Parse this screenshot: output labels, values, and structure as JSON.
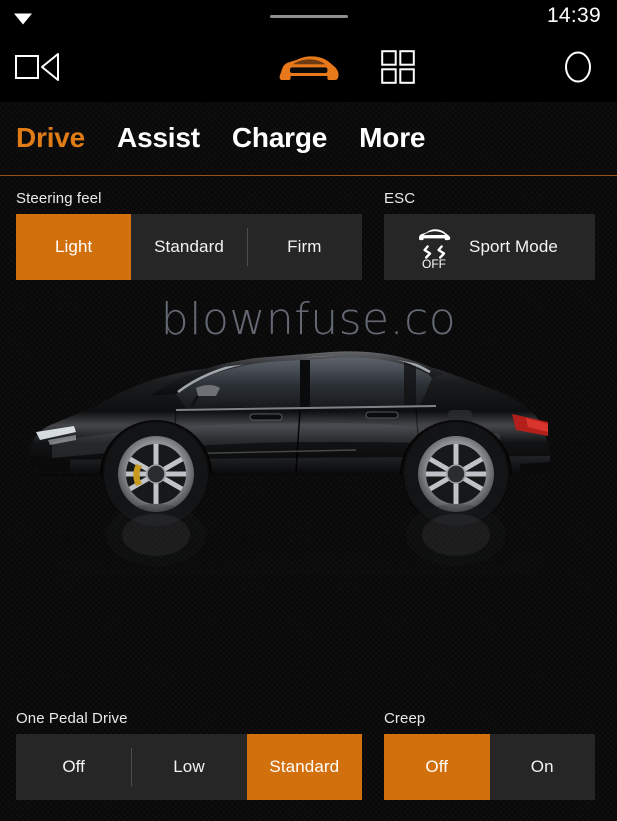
{
  "status_bar": {
    "wifi_icon": "wifi-icon",
    "drag_handle": "drag-handle",
    "time": "14:39"
  },
  "nav_bar": {
    "items": [
      {
        "name": "media-icon",
        "label": "Media"
      },
      {
        "name": "car-icon",
        "label": "Car"
      },
      {
        "name": "apps-icon",
        "label": "Apps"
      },
      {
        "name": "profile-icon",
        "label": "Profile"
      }
    ]
  },
  "tabs": [
    {
      "label": "Drive",
      "active": true
    },
    {
      "label": "Assist",
      "active": false
    },
    {
      "label": "Charge",
      "active": false
    },
    {
      "label": "More",
      "active": false
    }
  ],
  "controls": {
    "steering_feel": {
      "label": "Steering feel",
      "options": [
        {
          "label": "Light",
          "selected": true
        },
        {
          "label": "Standard",
          "selected": false
        },
        {
          "label": "Firm",
          "selected": false
        }
      ]
    },
    "esc": {
      "label": "ESC",
      "tile_label": "Sport Mode",
      "icon_name": "esc-off-icon",
      "icon_text": "OFF",
      "selected": false
    },
    "one_pedal_drive": {
      "label": "One Pedal Drive",
      "options": [
        {
          "label": "Off",
          "selected": false
        },
        {
          "label": "Low",
          "selected": false
        },
        {
          "label": "Standard",
          "selected": true
        }
      ]
    },
    "creep": {
      "label": "Creep",
      "options": [
        {
          "label": "Off",
          "selected": true
        },
        {
          "label": "On",
          "selected": false
        }
      ]
    }
  },
  "hero": {
    "watermark": "blownfuse.co",
    "vehicle_image_name": "vehicle-side-view"
  },
  "colors": {
    "accent_orange": "#d2700e",
    "tab_active": "#e07b16",
    "segment_bg": "#262626",
    "background": "#090909",
    "underline": "#9a5015"
  }
}
